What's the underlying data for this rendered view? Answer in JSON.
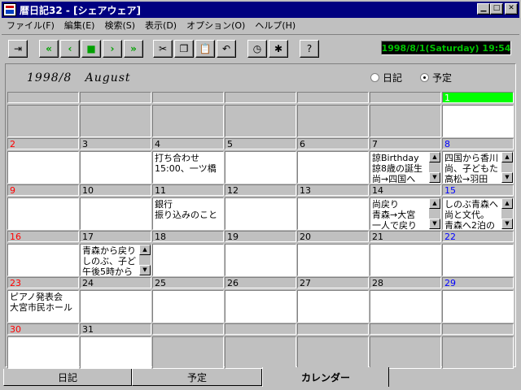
{
  "window": {
    "title": "暦日記32 - [シェアウェア]",
    "minimize_glyph": "▁",
    "maximize_glyph": "□",
    "close_glyph": "✕"
  },
  "menu": [
    "ファイル(F)",
    "編集(E)",
    "検索(S)",
    "表示(D)",
    "オプション(O)",
    "ヘルプ(H)"
  ],
  "toolbar": {
    "datetime": "1998/8/1(Saturday) 19:54",
    "icons": [
      "exit-icon",
      "first-icon",
      "prev-icon",
      "today-icon",
      "next-icon",
      "last-icon",
      "cut-icon",
      "copy-icon",
      "paste-icon",
      "undo-icon",
      "clock-icon",
      "stamp-icon",
      "help-icon"
    ],
    "glyphs": {
      "exit": "⇥",
      "first": "«",
      "prev": "‹",
      "today": "■",
      "next": "›",
      "last": "»",
      "cut": "✂",
      "copy": "❐",
      "paste": "📋",
      "undo": "↶",
      "clock": "◷",
      "stamp": "✱",
      "help": "?"
    }
  },
  "calendar": {
    "month_label": "1998/8   August",
    "view_options": [
      {
        "label": "日記",
        "selected": false
      },
      {
        "label": "予定",
        "selected": true
      }
    ],
    "days": [
      {
        "day": "",
        "lines": []
      },
      {
        "day": "",
        "lines": []
      },
      {
        "day": "",
        "lines": []
      },
      {
        "day": "",
        "lines": []
      },
      {
        "day": "",
        "lines": []
      },
      {
        "day": "",
        "lines": []
      },
      {
        "day": "1",
        "lines": [],
        "today": true,
        "color": "#0000ff"
      },
      {
        "day": "2",
        "lines": [],
        "color": "#ff0000"
      },
      {
        "day": "3",
        "lines": []
      },
      {
        "day": "4",
        "lines": [
          "打ち合わせ",
          "15:00、一ツ橋"
        ]
      },
      {
        "day": "5",
        "lines": []
      },
      {
        "day": "6",
        "lines": []
      },
      {
        "day": "7",
        "lines": [
          "諒Birthday",
          "諒8歳の誕生",
          "尚→四国へ"
        ],
        "scroll": true
      },
      {
        "day": "8",
        "lines": [
          "四国から香川",
          "尚、子どもた",
          "高松→羽田"
        ],
        "color": "#0000ff",
        "scroll": true
      },
      {
        "day": "9",
        "lines": [],
        "color": "#ff0000"
      },
      {
        "day": "10",
        "lines": []
      },
      {
        "day": "11",
        "lines": [
          "銀行",
          "振り込みのこと"
        ]
      },
      {
        "day": "12",
        "lines": []
      },
      {
        "day": "13",
        "lines": []
      },
      {
        "day": "14",
        "lines": [
          "尚戻り",
          "青森→大宮",
          "一人で戻り"
        ],
        "scroll": true
      },
      {
        "day": "15",
        "lines": [
          "しのぶ青森へ",
          "尚と文代。",
          "青森へ2泊の"
        ],
        "color": "#0000ff",
        "scroll": true
      },
      {
        "day": "16",
        "lines": [],
        "color": "#ff0000"
      },
      {
        "day": "17",
        "lines": [
          "青森から戻り",
          "しのぶ、子ど",
          "午後5時から"
        ],
        "scroll": true
      },
      {
        "day": "18",
        "lines": []
      },
      {
        "day": "19",
        "lines": []
      },
      {
        "day": "20",
        "lines": []
      },
      {
        "day": "21",
        "lines": []
      },
      {
        "day": "22",
        "lines": [],
        "color": "#0000ff"
      },
      {
        "day": "23",
        "lines": [
          "ピアノ発表会",
          "大宮市民ホール"
        ],
        "color": "#ff0000"
      },
      {
        "day": "24",
        "lines": []
      },
      {
        "day": "25",
        "lines": []
      },
      {
        "day": "26",
        "lines": []
      },
      {
        "day": "27",
        "lines": []
      },
      {
        "day": "28",
        "lines": []
      },
      {
        "day": "29",
        "lines": [],
        "color": "#0000ff"
      },
      {
        "day": "30",
        "lines": [],
        "color": "#ff0000"
      },
      {
        "day": "31",
        "lines": []
      },
      {
        "day": "",
        "lines": []
      },
      {
        "day": "",
        "lines": []
      },
      {
        "day": "",
        "lines": []
      },
      {
        "day": "",
        "lines": []
      },
      {
        "day": "",
        "lines": []
      }
    ]
  },
  "tabs": [
    {
      "label": "日記",
      "active": false
    },
    {
      "label": "予定",
      "active": false
    },
    {
      "label": "カレンダー",
      "active": true
    }
  ]
}
